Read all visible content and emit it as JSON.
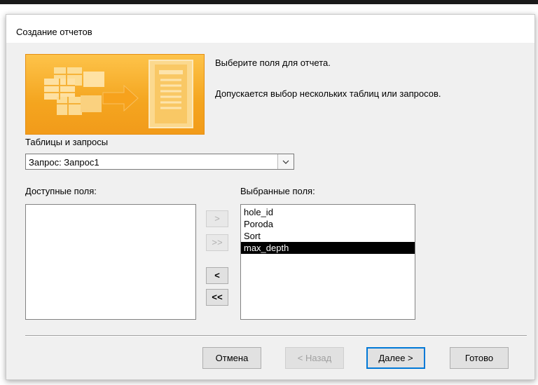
{
  "dialog": {
    "title": "Создание отчетов",
    "description_line1": "Выберите поля для отчета.",
    "description_line2": "Допускается выбор нескольких таблиц или запросов."
  },
  "source": {
    "label": "Таблицы и запросы",
    "selected_value": "Запрос: Запрос1"
  },
  "available_fields": {
    "label": "Доступные поля:",
    "items": []
  },
  "selected_fields": {
    "label": "Выбранные поля:",
    "items": [
      "hole_id",
      "Poroda",
      "Sort",
      "max_depth"
    ],
    "highlighted_index": 3
  },
  "move_buttons": {
    "add_one": ">",
    "add_all": ">>",
    "remove_one": "<",
    "remove_all": "<<"
  },
  "footer": {
    "cancel": "Отмена",
    "back": "< Назад",
    "next": "Далее >",
    "finish": "Готово"
  },
  "colors": {
    "banner_accent": "#f4a51f",
    "default_button_border": "#0078d7"
  }
}
